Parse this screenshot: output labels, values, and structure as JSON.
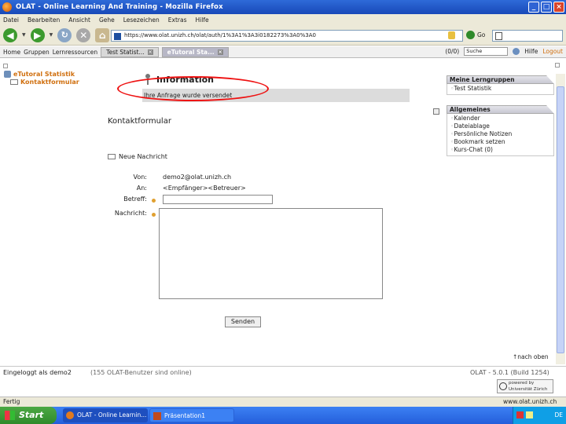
{
  "window": {
    "title": "OLAT - Online Learning And Training - Mozilla Firefox"
  },
  "menu": [
    "Datei",
    "Bearbeiten",
    "Ansicht",
    "Gehe",
    "Lesezeichen",
    "Extras",
    "Hilfe"
  ],
  "address": {
    "url": "https://www.olat.unizh.ch/olat/auth/1%3A1%3A3i0182273%3A0%3A0",
    "go_label": "Go"
  },
  "olat_tabs": {
    "home": "Home",
    "groups": "Gruppen",
    "resources": "Lernressourcen",
    "tab1": "Test Statist...",
    "tab2": "eTutoral Sta...",
    "counter": "(0/0)",
    "search_placeholder": "Suche",
    "help": "Hilfe",
    "logout": "Logout"
  },
  "leftnav": {
    "root": "eTutoral Statistik",
    "item": "Kontaktformular"
  },
  "info": {
    "title": "Information",
    "message": "Ihre Anfrage wurde versendet"
  },
  "form": {
    "heading": "Kontaktformular",
    "subheading": "Neue Nachricht",
    "from_label": "Von:",
    "from_value": "demo2@olat.unizh.ch",
    "to_label": "An:",
    "to_value": "<Empfänger><Betreuer>",
    "subject_label": "Betreff:",
    "subject_value": "",
    "message_label": "Nachricht:",
    "message_value": "",
    "send_label": "Senden"
  },
  "to_top": "nach oben",
  "portlets": {
    "groups": {
      "title": "Meine Lerngruppen",
      "items": [
        "Test Statistik"
      ]
    },
    "general": {
      "title": "Allgemeines",
      "items": [
        "Kalender",
        "Dateiablage",
        "Persönliche Notizen",
        "Bookmark setzen",
        "Kurs-Chat (0)"
      ]
    }
  },
  "footer": {
    "login": "Eingeloggt als demo2",
    "online": "(155 OLAT-Benutzer sind online)",
    "version": "OLAT - 5.0.1 (Build 1254)",
    "powered": "powered by",
    "university": "Universität Zürich"
  },
  "statusbar": {
    "left": "Fertig",
    "right": "www.olat.unizh.ch"
  },
  "taskbar": {
    "start": "Start",
    "item1": "OLAT - Online Learnin...",
    "item2": "Präsentation1",
    "time": "DE"
  },
  "colors": {
    "accent_orange": "#d07010",
    "highlight_red": "#e11"
  }
}
